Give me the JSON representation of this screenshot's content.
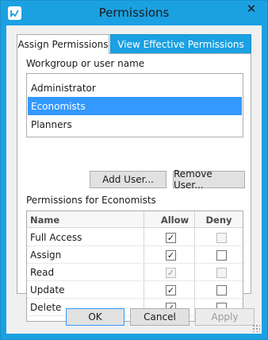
{
  "window": {
    "title": "Permissions",
    "close_glyph": "✕",
    "accent_color": "#1ba1e2"
  },
  "tabs": [
    {
      "label": "Assign Permissions",
      "active": true
    },
    {
      "label": "View Effective Permissions",
      "active": false
    }
  ],
  "users_section": {
    "label": "Workgroup or user name",
    "items": [
      {
        "label": "Administrator",
        "selected": false
      },
      {
        "label": "Economists",
        "selected": true
      },
      {
        "label": "Planners",
        "selected": false
      }
    ],
    "add_button": "Add User...",
    "remove_button": "Remove User..."
  },
  "permissions_section": {
    "label": "Permissions for Economists",
    "columns": {
      "name": "Name",
      "allow": "Allow",
      "deny": "Deny"
    },
    "rows": [
      {
        "name": "Full Access",
        "allow": true,
        "deny": false,
        "allow_disabled": false,
        "deny_disabled": true
      },
      {
        "name": "Assign",
        "allow": true,
        "deny": false,
        "allow_disabled": false,
        "deny_disabled": false
      },
      {
        "name": "Read",
        "allow": true,
        "deny": false,
        "allow_disabled": true,
        "deny_disabled": true
      },
      {
        "name": "Update",
        "allow": true,
        "deny": false,
        "allow_disabled": false,
        "deny_disabled": false
      },
      {
        "name": "Delete",
        "allow": true,
        "deny": false,
        "allow_disabled": false,
        "deny_disabled": false
      }
    ]
  },
  "footer": {
    "ok": "OK",
    "cancel": "Cancel",
    "apply": "Apply"
  }
}
